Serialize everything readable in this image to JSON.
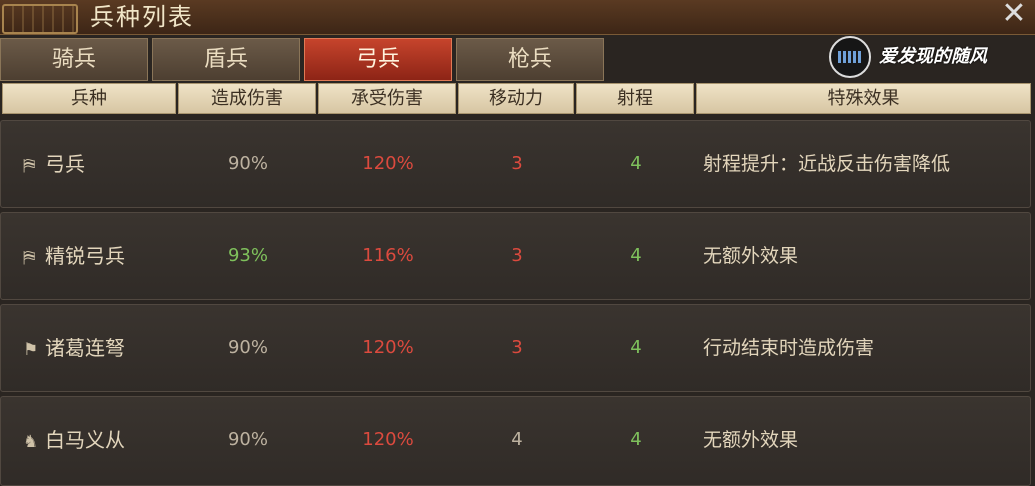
{
  "window": {
    "title": "兵种列表",
    "close_glyph": "✕"
  },
  "tabs": [
    {
      "label": "骑兵",
      "active": false
    },
    {
      "label": "盾兵",
      "active": false
    },
    {
      "label": "弓兵",
      "active": true
    },
    {
      "label": "枪兵",
      "active": false
    }
  ],
  "watermark": {
    "text": "爱发现的随风"
  },
  "columns": [
    "兵种",
    "造成伤害",
    "承受伤害",
    "移动力",
    "射程",
    "特殊效果"
  ],
  "rows": [
    {
      "icon": "bow-flag-icon",
      "glyph": "⛿",
      "name": "弓兵",
      "deal": "90%",
      "deal_color": "grey",
      "take": "120%",
      "move": "3",
      "move_color": "red",
      "range": "4",
      "effect": "射程提升：近战反击伤害降低"
    },
    {
      "icon": "bow-flag-icon",
      "glyph": "⛿",
      "name": "精锐弓兵",
      "deal": "93%",
      "deal_color": "green",
      "take": "116%",
      "move": "3",
      "move_color": "red",
      "range": "4",
      "effect": "无额外效果"
    },
    {
      "icon": "crossbow-flag-icon",
      "glyph": "⚑",
      "name": "诸葛连弩",
      "deal": "90%",
      "deal_color": "grey",
      "take": "120%",
      "move": "3",
      "move_color": "red",
      "range": "4",
      "effect": "行动结束时造成伤害"
    },
    {
      "icon": "horse-icon",
      "glyph": "♞",
      "name": "白马义从",
      "deal": "90%",
      "deal_color": "grey",
      "take": "120%",
      "move": "4",
      "move_color": "grey",
      "range": "4",
      "effect": "无额外效果"
    }
  ],
  "colors": {
    "grey": "#bdb2a0",
    "red": "#dc4a3e",
    "green": "#7fc15c",
    "active_tab": "#c6442c"
  }
}
